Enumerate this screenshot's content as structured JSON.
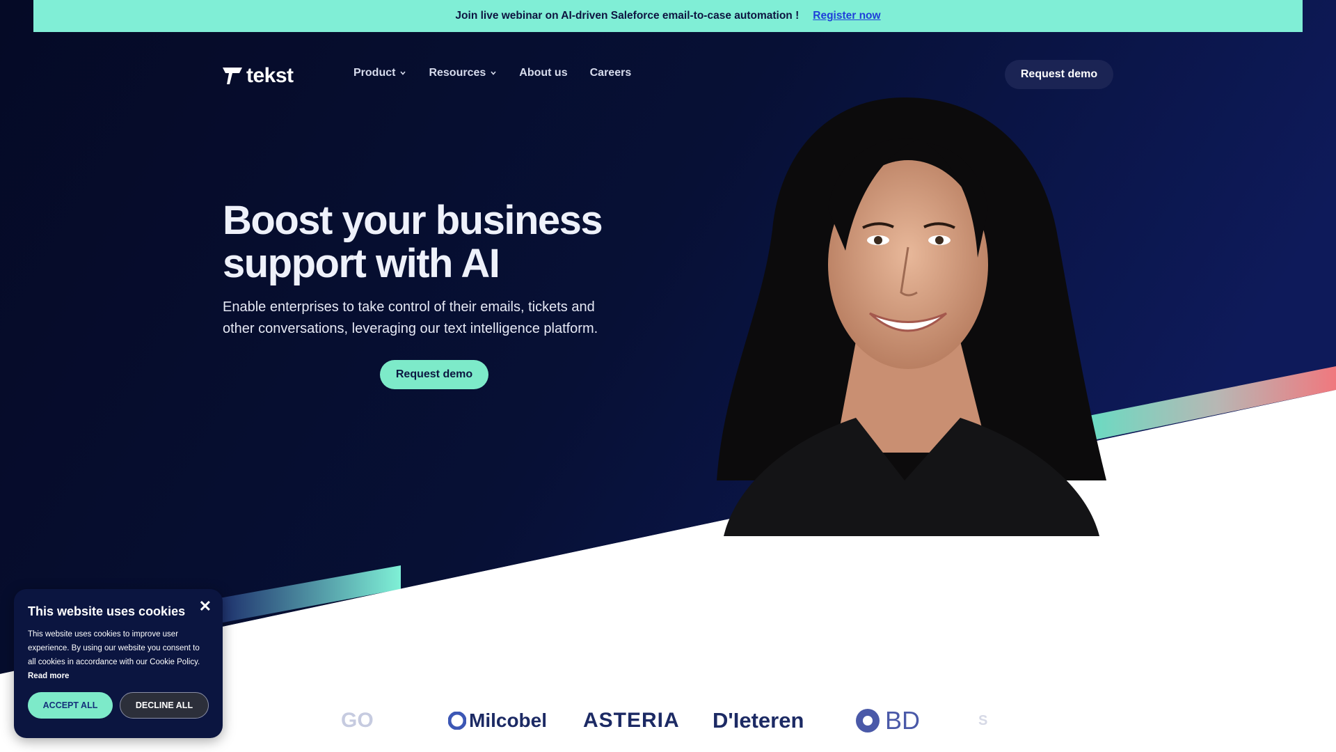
{
  "announcement": {
    "text": "Join live webinar on AI-driven Saleforce email-to-case automation !",
    "link": "Register now"
  },
  "brand": {
    "name": "tekst"
  },
  "nav": {
    "items": [
      {
        "label": "Product",
        "has_dropdown": true
      },
      {
        "label": "Resources",
        "has_dropdown": true
      },
      {
        "label": "About us",
        "has_dropdown": false
      },
      {
        "label": "Careers",
        "has_dropdown": false
      }
    ],
    "cta": "Request demo"
  },
  "hero": {
    "title_line1": "Boost your business",
    "title_line2": "support with AI",
    "subtitle_line1": "Enable enterprises to take control of their emails, tickets and",
    "subtitle_line2": "other conversations, leveraging our text intelligence platform.",
    "cta": "Request demo"
  },
  "clients": {
    "faded_left": "GO",
    "milcobel": "Milcobel",
    "asteria": "ASTERIA",
    "dieteren": "D'Ieteren",
    "bd": "BD",
    "faded_right": "S"
  },
  "cookie": {
    "title": "This website uses cookies",
    "body": "This website uses cookies to improve user experience. By using our website you consent to all cookies in accordance with our Cookie Policy.",
    "read_more": "Read more",
    "accept": "ACCEPT ALL",
    "decline": "DECLINE ALL",
    "close": "✕"
  },
  "colors": {
    "hero_dark": "#060b2b",
    "announce_bg": "#80eed6",
    "accent_mint": "#7deac9",
    "accent_coral": "#ef7f86",
    "link_blue": "#1f3fd9"
  }
}
